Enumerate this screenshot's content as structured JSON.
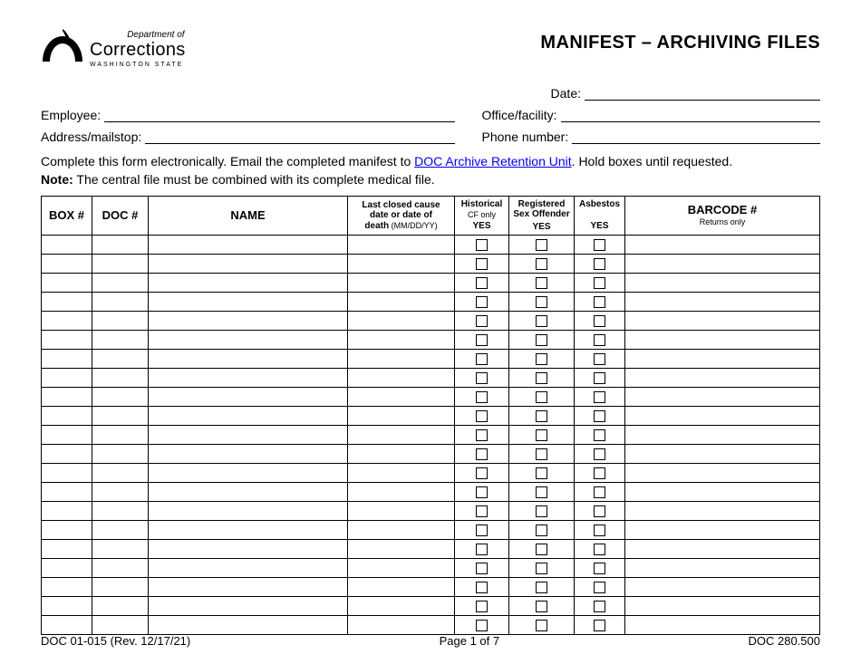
{
  "logo": {
    "dept_of": "Department of",
    "corrections": "Corrections",
    "state": "WASHINGTON STATE"
  },
  "title": "MANIFEST – ARCHIVING FILES",
  "fields": {
    "date_label": "Date:",
    "employee_label": "Employee:",
    "office_label": "Office/facility:",
    "address_label": "Address/mailstop:",
    "phone_label": "Phone number:",
    "date_value": "",
    "employee_value": "",
    "office_value": "",
    "address_value": "",
    "phone_value": ""
  },
  "instructions": {
    "pre_link": "Complete this form electronically.  Email the completed manifest to ",
    "link_text": "DOC Archive Retention Unit",
    "post_link": ".  Hold boxes until requested."
  },
  "note": {
    "bold": "Note:",
    "text": "  The central file must be combined with its complete medical file."
  },
  "headers": {
    "box": "BOX #",
    "doc": "DOC #",
    "name": "NAME",
    "last_closed_l1": "Last closed cause",
    "last_closed_l2": "date or date of",
    "last_closed_l3_bold": "death",
    "last_closed_l3_rest": " (MM/DD/YY)",
    "historical_l1": "Historical",
    "historical_l2": "CF only",
    "registered_l1": "Registered",
    "registered_l2": "Sex Offender",
    "asbestos_l1": "Asbestos",
    "yes": "YES",
    "barcode": "BARCODE #",
    "barcode_sub": "Returns only"
  },
  "row_count": 21,
  "footer": {
    "left": "DOC 01-015 (Rev. 12/17/21)",
    "center": "Page 1 of 7",
    "right": "DOC 280.500"
  }
}
